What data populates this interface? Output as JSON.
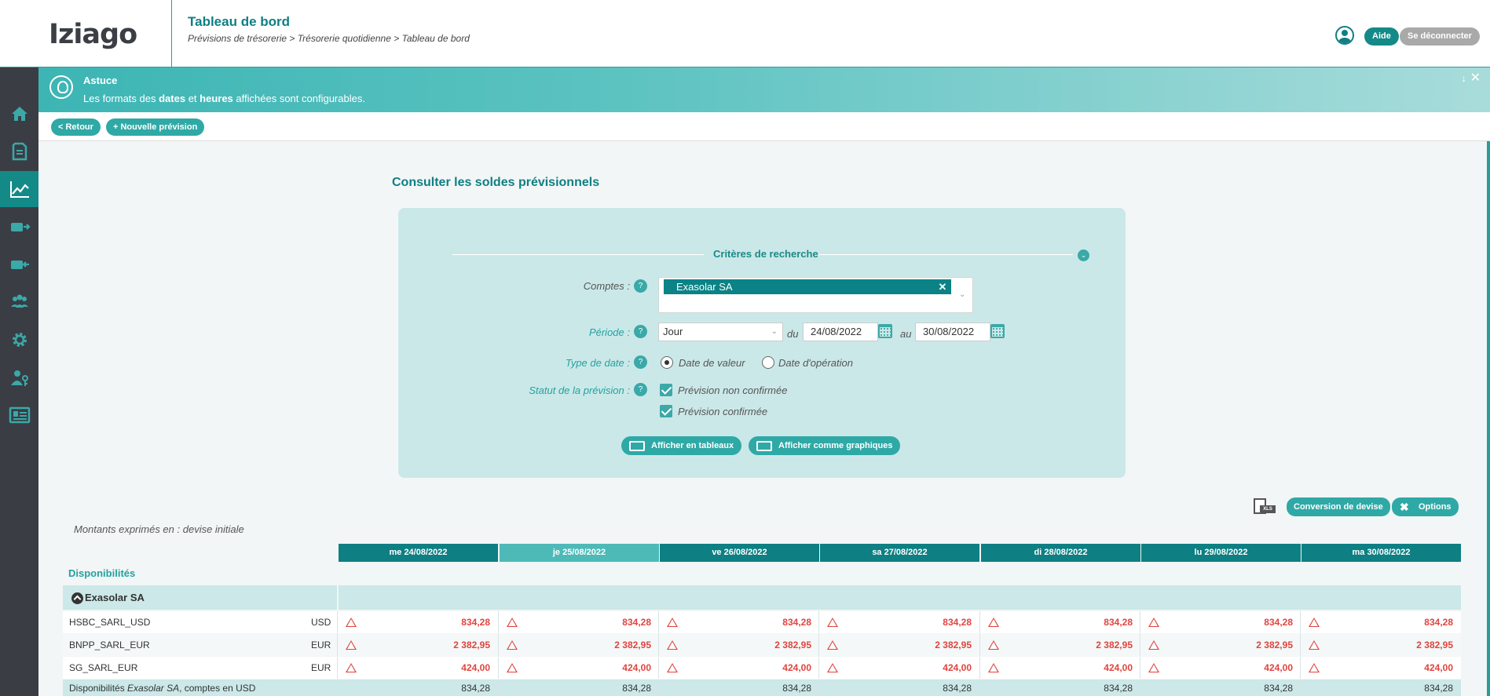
{
  "header": {
    "logo": "Iziago",
    "title": "Tableau de bord",
    "breadcrumb": "Prévisions de trésorerie > Trésorerie quotidienne > Tableau de bord",
    "help_label": "Aide",
    "logout_label": "Se déconnecter"
  },
  "sidebar": {
    "icons": [
      "home-icon",
      "document-icon",
      "chart-line-icon",
      "wallet-out-icon",
      "wallet-in-icon",
      "users-icon",
      "gear-icon",
      "user-key-icon",
      "id-card-icon"
    ],
    "active_index": 2
  },
  "tip": {
    "title": "Astuce",
    "text_before": "Les formats des ",
    "bold1": "dates",
    "text_mid": " et ",
    "bold2": "heures",
    "text_after": " affichées sont configurables."
  },
  "actions": {
    "back": "< Retour",
    "new_forecast": "+ Nouvelle prévision"
  },
  "section_title": "Consulter les soldes prévisionnels",
  "criteria": {
    "title": "Critères de recherche",
    "accounts_label": "Comptes :",
    "account_selected": "Exasolar SA",
    "period_label": "Période :",
    "period_value": "Jour",
    "du": "du",
    "au": "au",
    "date_from": "24/08/2022",
    "date_to": "30/08/2022",
    "date_type_label": "Type de date :",
    "date_type_options": [
      "Date de valeur",
      "Date d'opération"
    ],
    "date_type_selected": 0,
    "status_label": "Statut de la prévision :",
    "status_options": [
      "Prévision non confirmée",
      "Prévision confirmée"
    ],
    "show_tables": "Afficher en tableaux",
    "show_charts": "Afficher comme graphiques"
  },
  "tools": {
    "xls": "XLS",
    "currency_conversion": "Conversion de devise",
    "options": "Options"
  },
  "amounts_note": "Montants exprimés en : devise initiale",
  "table": {
    "columns": [
      "me 24/08/2022",
      "je 25/08/2022",
      "ve 26/08/2022",
      "sa 27/08/2022",
      "di 28/08/2022",
      "lu 29/08/2022",
      "ma 30/08/2022"
    ],
    "highlight_col": 1,
    "section": "Disponibilités",
    "group": "Exasolar SA",
    "rows": [
      {
        "name": "HSBC_SARL_USD",
        "currency": "USD",
        "values": [
          "834,28",
          "834,28",
          "834,28",
          "834,28",
          "834,28",
          "834,28",
          "834,28"
        ]
      },
      {
        "name": "BNPP_SARL_EUR",
        "currency": "EUR",
        "values": [
          "2 382,95",
          "2 382,95",
          "2 382,95",
          "2 382,95",
          "2 382,95",
          "2 382,95",
          "2 382,95"
        ]
      },
      {
        "name": "SG_SARL_EUR",
        "currency": "EUR",
        "values": [
          "424,00",
          "424,00",
          "424,00",
          "424,00",
          "424,00",
          "424,00",
          "424,00"
        ]
      }
    ],
    "total_row": {
      "label_prefix": "Disponibilités ",
      "label_company": "Exasolar SA",
      "label_suffix": ", comptes en USD",
      "values": [
        "834,28",
        "834,28",
        "834,28",
        "834,28",
        "834,28",
        "834,28",
        "834,28"
      ]
    }
  }
}
